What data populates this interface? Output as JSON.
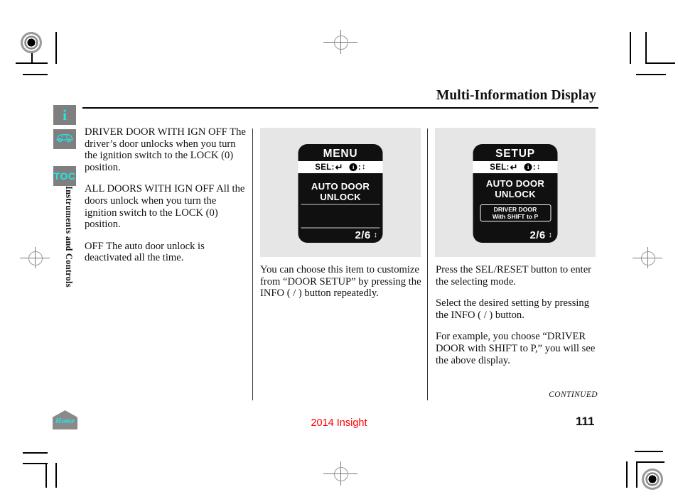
{
  "header": {
    "title": "Multi-Information Display"
  },
  "sidebar": {
    "info_icon": "i",
    "info_icon_name": "info-icon",
    "car_icon_name": "car-icon",
    "toc_label": "TOC",
    "vertical_label": "Instruments and Controls"
  },
  "columns": {
    "col1": [
      "DRIVER DOOR WITH IGN OFF The driver’s door unlocks when you turn the ignition switch to the LOCK (0) position.",
      "ALL DOORS WITH IGN OFF     All the doors unlock when you turn the ignition switch to the LOCK (0) position.",
      "OFF      The auto door unlock is deactivated all the time."
    ],
    "col2": [
      "You can choose this item to customize from “DOOR SETUP” by  pressing the INFO (   /   ) button  repeatedly."
    ],
    "col3": [
      "Press the SEL/RESET button to enter the selecting mode.",
      "Select the desired setting by pressing the INFO (   /   ) button.",
      "For example, you choose “DRIVER DOOR with SHIFT to P,” you will see the above display."
    ]
  },
  "display_menu": {
    "title": "MENU",
    "bar_left_label": "SEL:",
    "bar_left_glyph": "↵",
    "bar_right_label": ":",
    "bar_right_badge": "i",
    "bar_right_glyph": "↕",
    "body_line1": "AUTO DOOR",
    "body_line2": "UNLOCK",
    "page_indicator": "2/6",
    "page_glyph": "↕"
  },
  "display_setup": {
    "title": "SETUP",
    "bar_left_label": "SEL:",
    "bar_left_glyph": "↵",
    "bar_right_label": ":",
    "bar_right_badge": "i",
    "bar_right_glyph": "↕",
    "body_line1": "AUTO DOOR",
    "body_line2": "UNLOCK",
    "setting_line1": "DRIVER DOOR",
    "setting_line2": "With SHIFT to P",
    "page_indicator": "2/6",
    "page_glyph": "↕"
  },
  "footer": {
    "continued": "CONTINUED",
    "home_label": "Home",
    "model_year": "2014 Insight",
    "page_number": "111"
  },
  "colors": {
    "accent_cyan": "#23e6e6",
    "model_year_red": "#ff0000",
    "icon_gray": "#7f7f7f",
    "figure_bg": "#e6e6e6"
  }
}
